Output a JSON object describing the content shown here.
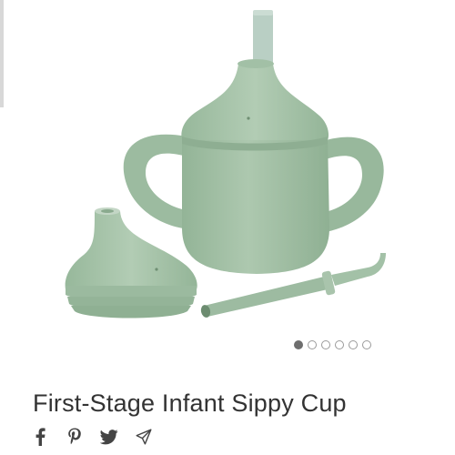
{
  "product": {
    "title": "First-Stage Infant Sippy Cup"
  },
  "gallery": {
    "image_count": 6,
    "active_index": 0
  },
  "share": {
    "icons": [
      "facebook-icon",
      "pinterest-icon",
      "twitter-icon",
      "send-icon"
    ]
  },
  "colors": {
    "product_sage": "#a8c3aa",
    "product_shadow": "#8fb093",
    "dot_active": "#6e6e6e",
    "dot_inactive_border": "#9a9a9a",
    "title_text": "#333333"
  }
}
